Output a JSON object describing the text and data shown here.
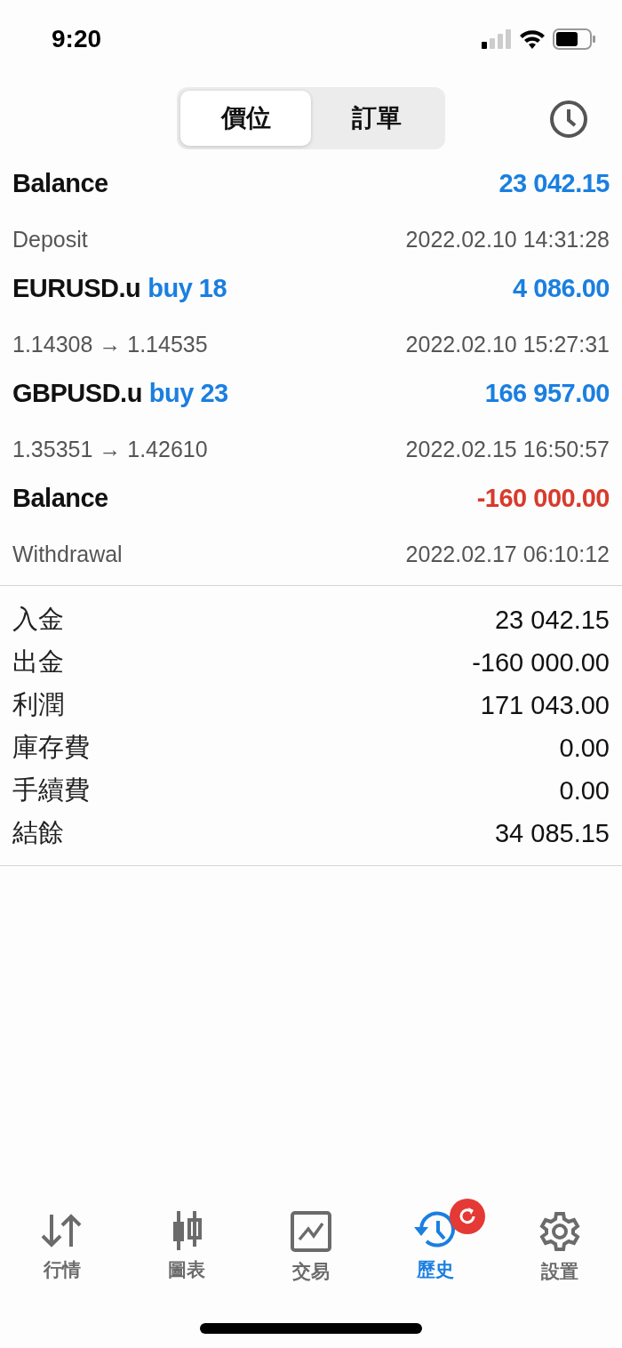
{
  "status_bar": {
    "time": "9:20"
  },
  "segments": [
    {
      "label": "價位",
      "selected": true
    },
    {
      "label": "訂單",
      "selected": false
    }
  ],
  "deals": [
    {
      "kind": "balance",
      "title": "Balance",
      "amount": "23 042.15",
      "negative": false,
      "subtitle": "Deposit",
      "time": "2022.02.10 14:31:28"
    },
    {
      "kind": "trade",
      "title": "EURUSD.u",
      "side": "buy 18",
      "amount": "4 086.00",
      "negative": false,
      "subtitle": "1.14308 → 1.14535",
      "time": "2022.02.10 15:27:31"
    },
    {
      "kind": "trade",
      "title": "GBPUSD.u",
      "side": "buy 23",
      "amount": "166 957.00",
      "negative": false,
      "subtitle": "1.35351 → 1.42610",
      "time": "2022.02.15 16:50:57"
    },
    {
      "kind": "balance",
      "title": "Balance",
      "amount": "-160 000.00",
      "negative": true,
      "subtitle": "Withdrawal",
      "time": "2022.02.17 06:10:12"
    }
  ],
  "summary": [
    {
      "label": "入金",
      "value": "23 042.15"
    },
    {
      "label": "出金",
      "value": "-160 000.00"
    },
    {
      "label": "利潤",
      "value": "171 043.00"
    },
    {
      "label": "庫存費",
      "value": "0.00"
    },
    {
      "label": "手續費",
      "value": "0.00"
    },
    {
      "label": "結餘",
      "value": "34 085.15"
    }
  ],
  "tab_bar": [
    {
      "kind": "quotes",
      "label": "行情",
      "selected": false
    },
    {
      "kind": "chart",
      "label": "圖表",
      "selected": false
    },
    {
      "kind": "trade",
      "label": "交易",
      "selected": false
    },
    {
      "kind": "history",
      "label": "歷史",
      "selected": true,
      "badge": true
    },
    {
      "kind": "settings",
      "label": "設置",
      "selected": false
    }
  ]
}
